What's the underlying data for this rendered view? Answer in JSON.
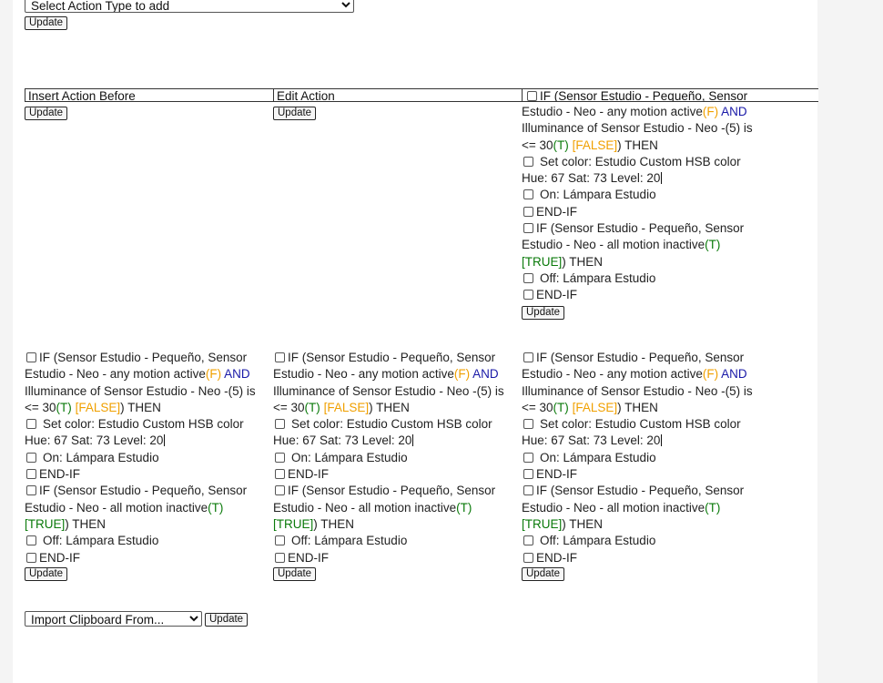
{
  "top": {
    "action_select": "Select Action Type to add",
    "update_label": "Update"
  },
  "table": {
    "headers": [
      "Insert Action Before",
      "Edit Action",
      "IF (Sensor Estudio - Pequeño, Sensor"
    ],
    "update_label": "Update"
  },
  "actions": {
    "if1_a": "IF (Sensor Estudio - Pequeño, Sensor Estudio - Neo - any motion active",
    "if1_f": "(F)",
    "if1_and": "AND",
    "if1_b": "Illuminance of Sensor Estudio - Neo -(5) is <= 30",
    "if1_t": "(T)",
    "if1_false": "[FALSE]",
    "if1_then": ") THEN",
    "if1_rest": "Estudio - Neo - any motion active",
    "set_color": "Set color: Estudio Custom HSB color Hue: 67 Sat: 73 Level: 20",
    "on": "On: Lámpara Estudio",
    "endif": "END-IF",
    "if2_a": "IF (Sensor Estudio - Pequeño, Sensor Estudio - Neo - all motion inactive",
    "if2_rest": "Estudio - Neo - all motion inactive",
    "if2_t": "(T)",
    "if2_true": "[TRUE]",
    "if2_then": ") THEN",
    "off": "Off: Lámpara Estudio"
  },
  "bottom": {
    "clipboard_select": "Import Clipboard From...",
    "update_label": "Update"
  }
}
